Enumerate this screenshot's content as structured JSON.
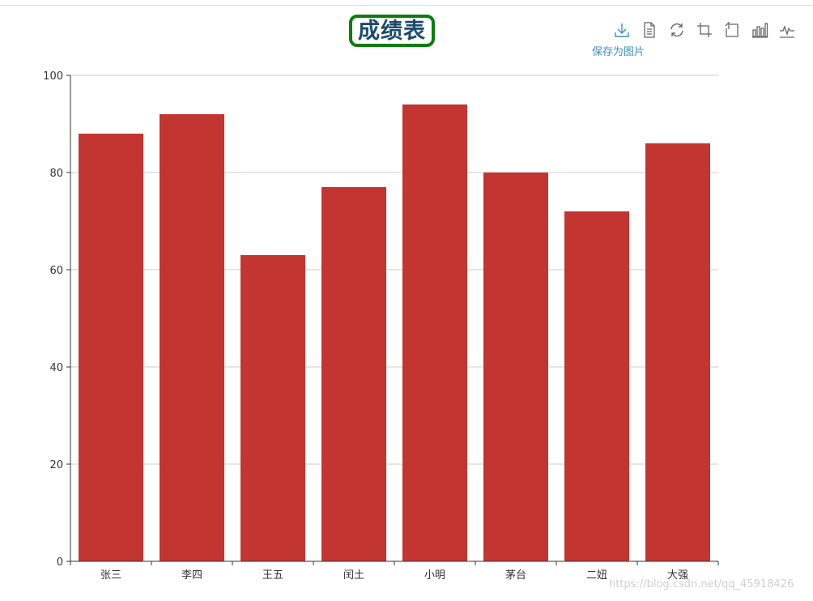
{
  "chart_data": {
    "type": "bar",
    "title": "成绩表",
    "categories": [
      "张三",
      "李四",
      "王五",
      "闰土",
      "小明",
      "茅台",
      "二妞",
      "大强"
    ],
    "values": [
      88,
      92,
      63,
      77,
      94,
      80,
      72,
      86
    ],
    "xlabel": "",
    "ylabel": "",
    "ylim": [
      0,
      100
    ],
    "yticks": [
      0,
      20,
      40,
      60,
      80,
      100
    ],
    "grid": true,
    "colors": {
      "bar": "#c23531",
      "axis": "#333333",
      "grid": "#cccccc",
      "title_border": "#0e7d0e",
      "title_text": "#1a4a6e"
    }
  },
  "toolbox": {
    "icons": [
      "download-icon",
      "data-view-icon",
      "restore-icon",
      "zoom-icon",
      "zoom-back-icon",
      "bar-chart-icon",
      "line-chart-icon"
    ],
    "save_tooltip": "保存为图片",
    "active_color": "#3a8fc4",
    "icon_color": "#666666"
  },
  "watermark": "https://blog.csdn.net/qq_45918426"
}
